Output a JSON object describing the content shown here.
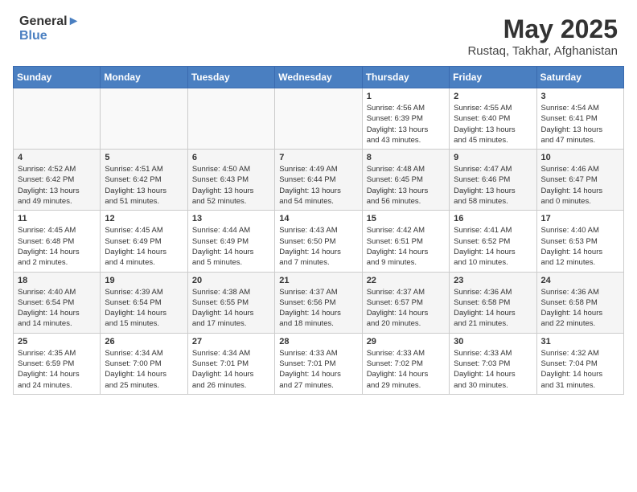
{
  "header": {
    "logo_general": "General",
    "logo_blue": "Blue",
    "month_year": "May 2025",
    "location": "Rustaq, Takhar, Afghanistan"
  },
  "days_of_week": [
    "Sunday",
    "Monday",
    "Tuesday",
    "Wednesday",
    "Thursday",
    "Friday",
    "Saturday"
  ],
  "weeks": [
    [
      {
        "day": "",
        "info": ""
      },
      {
        "day": "",
        "info": ""
      },
      {
        "day": "",
        "info": ""
      },
      {
        "day": "",
        "info": ""
      },
      {
        "day": "1",
        "info": "Sunrise: 4:56 AM\nSunset: 6:39 PM\nDaylight: 13 hours\nand 43 minutes."
      },
      {
        "day": "2",
        "info": "Sunrise: 4:55 AM\nSunset: 6:40 PM\nDaylight: 13 hours\nand 45 minutes."
      },
      {
        "day": "3",
        "info": "Sunrise: 4:54 AM\nSunset: 6:41 PM\nDaylight: 13 hours\nand 47 minutes."
      }
    ],
    [
      {
        "day": "4",
        "info": "Sunrise: 4:52 AM\nSunset: 6:42 PM\nDaylight: 13 hours\nand 49 minutes."
      },
      {
        "day": "5",
        "info": "Sunrise: 4:51 AM\nSunset: 6:42 PM\nDaylight: 13 hours\nand 51 minutes."
      },
      {
        "day": "6",
        "info": "Sunrise: 4:50 AM\nSunset: 6:43 PM\nDaylight: 13 hours\nand 52 minutes."
      },
      {
        "day": "7",
        "info": "Sunrise: 4:49 AM\nSunset: 6:44 PM\nDaylight: 13 hours\nand 54 minutes."
      },
      {
        "day": "8",
        "info": "Sunrise: 4:48 AM\nSunset: 6:45 PM\nDaylight: 13 hours\nand 56 minutes."
      },
      {
        "day": "9",
        "info": "Sunrise: 4:47 AM\nSunset: 6:46 PM\nDaylight: 13 hours\nand 58 minutes."
      },
      {
        "day": "10",
        "info": "Sunrise: 4:46 AM\nSunset: 6:47 PM\nDaylight: 14 hours\nand 0 minutes."
      }
    ],
    [
      {
        "day": "11",
        "info": "Sunrise: 4:45 AM\nSunset: 6:48 PM\nDaylight: 14 hours\nand 2 minutes."
      },
      {
        "day": "12",
        "info": "Sunrise: 4:45 AM\nSunset: 6:49 PM\nDaylight: 14 hours\nand 4 minutes."
      },
      {
        "day": "13",
        "info": "Sunrise: 4:44 AM\nSunset: 6:49 PM\nDaylight: 14 hours\nand 5 minutes."
      },
      {
        "day": "14",
        "info": "Sunrise: 4:43 AM\nSunset: 6:50 PM\nDaylight: 14 hours\nand 7 minutes."
      },
      {
        "day": "15",
        "info": "Sunrise: 4:42 AM\nSunset: 6:51 PM\nDaylight: 14 hours\nand 9 minutes."
      },
      {
        "day": "16",
        "info": "Sunrise: 4:41 AM\nSunset: 6:52 PM\nDaylight: 14 hours\nand 10 minutes."
      },
      {
        "day": "17",
        "info": "Sunrise: 4:40 AM\nSunset: 6:53 PM\nDaylight: 14 hours\nand 12 minutes."
      }
    ],
    [
      {
        "day": "18",
        "info": "Sunrise: 4:40 AM\nSunset: 6:54 PM\nDaylight: 14 hours\nand 14 minutes."
      },
      {
        "day": "19",
        "info": "Sunrise: 4:39 AM\nSunset: 6:54 PM\nDaylight: 14 hours\nand 15 minutes."
      },
      {
        "day": "20",
        "info": "Sunrise: 4:38 AM\nSunset: 6:55 PM\nDaylight: 14 hours\nand 17 minutes."
      },
      {
        "day": "21",
        "info": "Sunrise: 4:37 AM\nSunset: 6:56 PM\nDaylight: 14 hours\nand 18 minutes."
      },
      {
        "day": "22",
        "info": "Sunrise: 4:37 AM\nSunset: 6:57 PM\nDaylight: 14 hours\nand 20 minutes."
      },
      {
        "day": "23",
        "info": "Sunrise: 4:36 AM\nSunset: 6:58 PM\nDaylight: 14 hours\nand 21 minutes."
      },
      {
        "day": "24",
        "info": "Sunrise: 4:36 AM\nSunset: 6:58 PM\nDaylight: 14 hours\nand 22 minutes."
      }
    ],
    [
      {
        "day": "25",
        "info": "Sunrise: 4:35 AM\nSunset: 6:59 PM\nDaylight: 14 hours\nand 24 minutes."
      },
      {
        "day": "26",
        "info": "Sunrise: 4:34 AM\nSunset: 7:00 PM\nDaylight: 14 hours\nand 25 minutes."
      },
      {
        "day": "27",
        "info": "Sunrise: 4:34 AM\nSunset: 7:01 PM\nDaylight: 14 hours\nand 26 minutes."
      },
      {
        "day": "28",
        "info": "Sunrise: 4:33 AM\nSunset: 7:01 PM\nDaylight: 14 hours\nand 27 minutes."
      },
      {
        "day": "29",
        "info": "Sunrise: 4:33 AM\nSunset: 7:02 PM\nDaylight: 14 hours\nand 29 minutes."
      },
      {
        "day": "30",
        "info": "Sunrise: 4:33 AM\nSunset: 7:03 PM\nDaylight: 14 hours\nand 30 minutes."
      },
      {
        "day": "31",
        "info": "Sunrise: 4:32 AM\nSunset: 7:04 PM\nDaylight: 14 hours\nand 31 minutes."
      }
    ]
  ]
}
